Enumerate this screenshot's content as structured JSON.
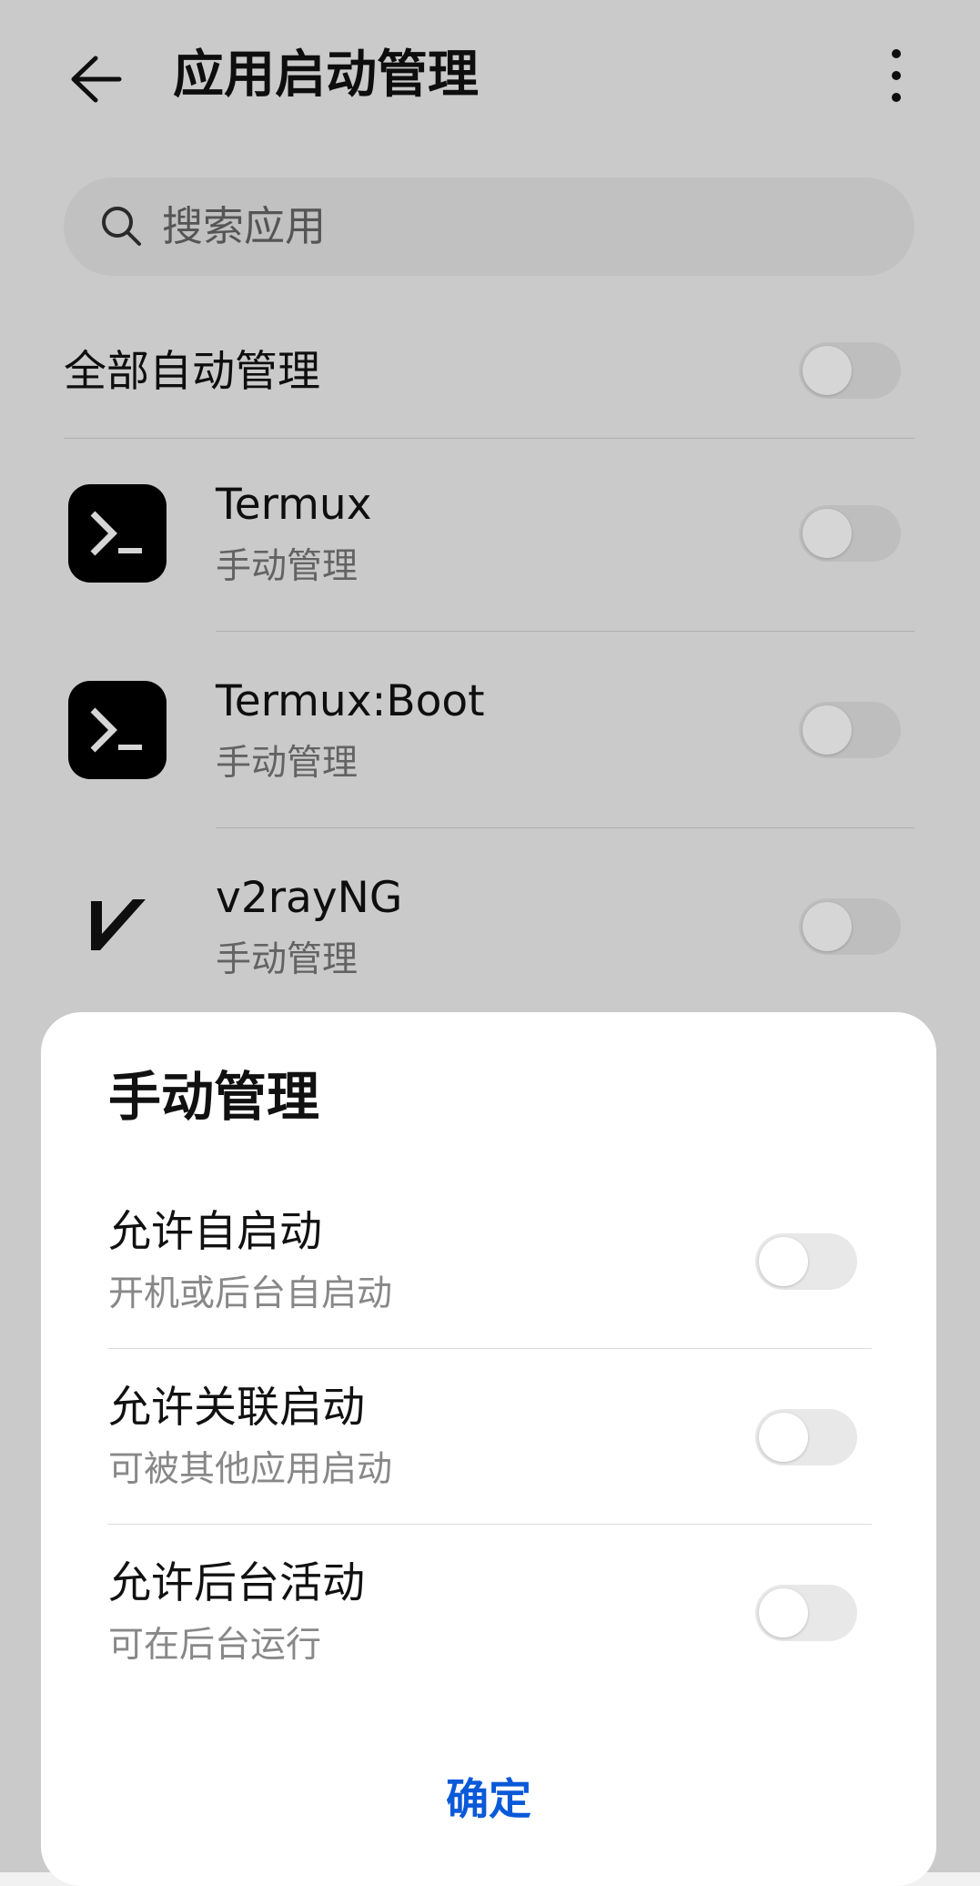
{
  "header": {
    "title": "应用启动管理"
  },
  "search": {
    "placeholder": "搜索应用"
  },
  "manage_all": {
    "label": "全部自动管理",
    "enabled": false
  },
  "apps": [
    {
      "name": "Termux",
      "status": "手动管理",
      "icon": "terminal-icon",
      "enabled": false
    },
    {
      "name": "Termux:Boot",
      "status": "手动管理",
      "icon": "terminal-icon",
      "enabled": false
    },
    {
      "name": "v2rayNG",
      "status": "手动管理",
      "icon": "v2rayng-logo-icon",
      "enabled": false
    }
  ],
  "dialog": {
    "title": "手动管理",
    "options": [
      {
        "label": "允许自启动",
        "description": "开机或后台自启动",
        "enabled": false
      },
      {
        "label": "允许关联启动",
        "description": "可被其他应用启动",
        "enabled": false
      },
      {
        "label": "允许后台活动",
        "description": "可在后台运行",
        "enabled": false
      }
    ],
    "confirm_label": "确定"
  },
  "colors": {
    "accent": "#0A59D9",
    "terminal_icon_bg": "#000000"
  }
}
